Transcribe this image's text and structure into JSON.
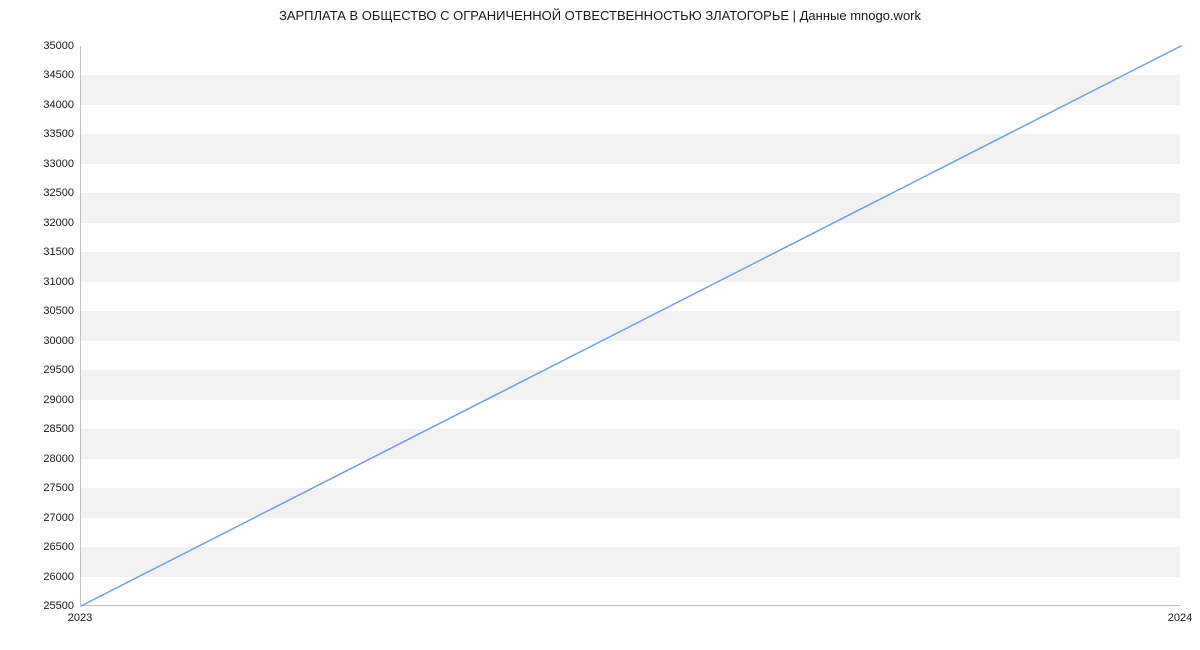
{
  "chart_data": {
    "type": "line",
    "title": "ЗАРПЛАТА В ОБЩЕСТВО С ОГРАНИЧЕННОЙ ОТВЕСТВЕННОСТЬЮ ЗЛАТОГОРЬЕ | Данные mnogo.work",
    "x": [
      "2023",
      "2024"
    ],
    "values": [
      25500,
      35000
    ],
    "xlabel": "",
    "ylabel": "",
    "ylim": [
      25500,
      35000
    ],
    "y_ticks": [
      25500,
      26000,
      26500,
      27000,
      27500,
      28000,
      28500,
      29000,
      29500,
      30000,
      30500,
      31000,
      31500,
      32000,
      32500,
      33000,
      33500,
      34000,
      34500,
      35000
    ],
    "line_color": "#6f9fe8"
  }
}
